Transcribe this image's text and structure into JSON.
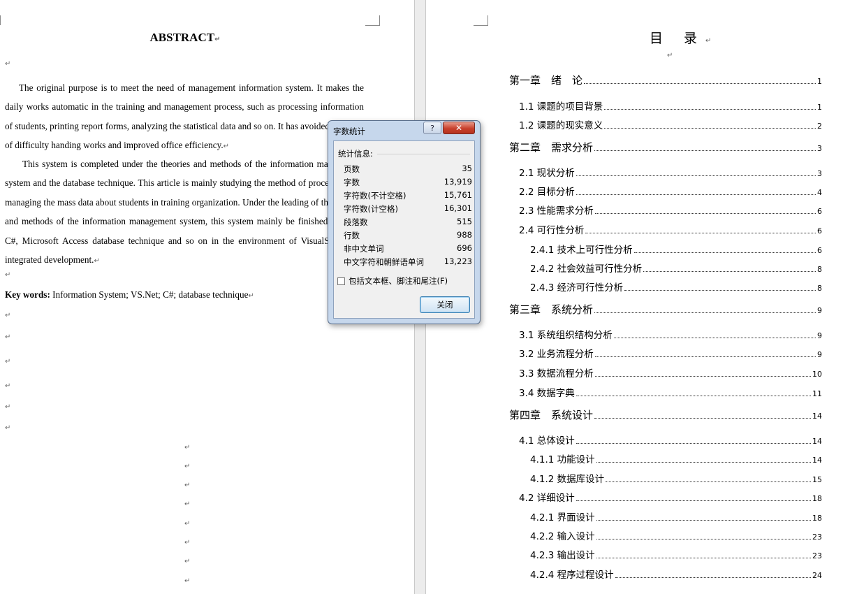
{
  "left_page": {
    "abstract_title": "ABSTRACT",
    "paragraphs": [
      "The original purpose is to meet the need of management information system. It makes the daily works automatic in the training and management process, such as processing information of students, printing report forms, analyzing the statistical data and so on. It has avoided the great of difficulty handing works and improved office efficiency.",
      "This system is completed under the theories and methods of the information management system and the database technique. This article is mainly studying the method of processing and managing the mass data about students in training organization. Under the leading of the theories and methods of the information management system, this system mainly be finished by using C#, Microsoft Access database technique and so on in the environment of VisualStudio.Net integrated development."
    ],
    "keywords_label": "Key words:",
    "keywords_text": " Information System; VS.Net; C#; database technique"
  },
  "right_page": {
    "toc_title": "目 录",
    "toc_entries": [
      {
        "label": "第一章　绪　论",
        "page": "1"
      },
      {
        "label": "1.1 课题的项目背景",
        "page": "1"
      },
      {
        "label": "1.2 课题的现实意义",
        "page": "2"
      },
      {
        "label": "第二章　需求分析",
        "page": "3"
      },
      {
        "label": "2.1 现状分析",
        "page": "3"
      },
      {
        "label": "2.2 目标分析",
        "page": "4"
      },
      {
        "label": "2.3 性能需求分析",
        "page": "6"
      },
      {
        "label": "2.4 可行性分析",
        "page": "6"
      },
      {
        "label": "2.4.1 技术上可行性分析",
        "page": "6"
      },
      {
        "label": "2.4.2 社会效益可行性分析",
        "page": "8"
      },
      {
        "label": "2.4.3 经济可行性分析",
        "page": "8"
      },
      {
        "label": "第三章　系统分析",
        "page": "9"
      },
      {
        "label": "3.1 系统组织结构分析",
        "page": "9"
      },
      {
        "label": "3.2 业务流程分析",
        "page": "9"
      },
      {
        "label": "3.3 数据流程分析",
        "page": "10"
      },
      {
        "label": "3.4 数据字典",
        "page": "11"
      },
      {
        "label": "第四章　系统设计",
        "page": "14"
      },
      {
        "label": "4.1 总体设计",
        "page": "14"
      },
      {
        "label": "4.1.1 功能设计",
        "page": "14"
      },
      {
        "label": "4.1.2 数据库设计",
        "page": "15"
      },
      {
        "label": "4.2 详细设计",
        "page": "18"
      },
      {
        "label": "4.2.1 界面设计",
        "page": "18"
      },
      {
        "label": "4.2.2 输入设计",
        "page": "23"
      },
      {
        "label": "4.2.3 输出设计",
        "page": "23"
      },
      {
        "label": "4.2.4 程序过程设计",
        "page": "24"
      }
    ]
  },
  "dialog": {
    "title": "字数统计",
    "help_label": "?",
    "close_x_label": "✕",
    "stats_label": "统计信息:",
    "stats": [
      {
        "label": "页数",
        "value": "35"
      },
      {
        "label": "字数",
        "value": "13,919"
      },
      {
        "label": "字符数(不计空格)",
        "value": "15,761"
      },
      {
        "label": "字符数(计空格)",
        "value": "16,301"
      },
      {
        "label": "段落数",
        "value": "515"
      },
      {
        "label": "行数",
        "value": "988"
      },
      {
        "label": "非中文单词",
        "value": "696"
      },
      {
        "label": "中文字符和朝鲜语单词",
        "value": "13,223"
      }
    ],
    "checkbox_label": "包括文本框、脚注和尾注(F)",
    "close_button_label": "关闭"
  },
  "icons": {
    "paragraph_mark": "↵",
    "help_icon": "question-mark",
    "close_icon": "close-x"
  }
}
